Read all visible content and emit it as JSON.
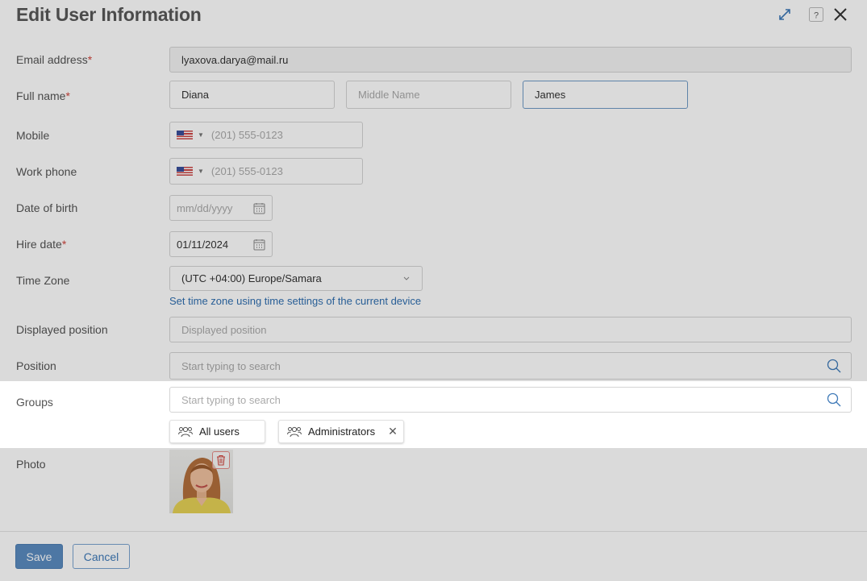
{
  "dialog": {
    "title": "Edit User Information"
  },
  "header_icons": {
    "expand": "expand-icon",
    "help": "help-icon",
    "close": "close-icon"
  },
  "form": {
    "email": {
      "label": "Email address",
      "required_mark": "*",
      "value": "lyaxova.darya@mail.ru"
    },
    "full_name": {
      "label": "Full name",
      "required_mark": "*",
      "first": "Diana",
      "middle_placeholder": "Middle Name",
      "last": "James"
    },
    "mobile": {
      "label": "Mobile",
      "placeholder": "(201) 555-0123",
      "country_icon": "us-flag-icon"
    },
    "work_phone": {
      "label": "Work phone",
      "placeholder": "(201) 555-0123",
      "country_icon": "us-flag-icon"
    },
    "date_of_birth": {
      "label": "Date of birth",
      "placeholder": "mm/dd/yyyy"
    },
    "hire_date": {
      "label": "Hire date",
      "required_mark": "*",
      "value": "01/11/2024"
    },
    "time_zone": {
      "label": "Time Zone",
      "value": "(UTC +04:00) Europe/Samara",
      "link": "Set time zone using time settings of the current device"
    },
    "displayed_position": {
      "label": "Displayed position",
      "placeholder": "Displayed position"
    },
    "position": {
      "label": "Position",
      "placeholder": "Start typing to search"
    },
    "groups": {
      "label": "Groups",
      "placeholder": "Start typing to search",
      "chips": [
        {
          "label": "All users"
        },
        {
          "label": "Administrators"
        }
      ]
    },
    "photo": {
      "label": "Photo"
    }
  },
  "footer": {
    "save": "Save",
    "cancel": "Cancel"
  },
  "colors": {
    "accent": "#5b8cc0",
    "required": "#d0443c",
    "link": "#2f6fb0"
  }
}
